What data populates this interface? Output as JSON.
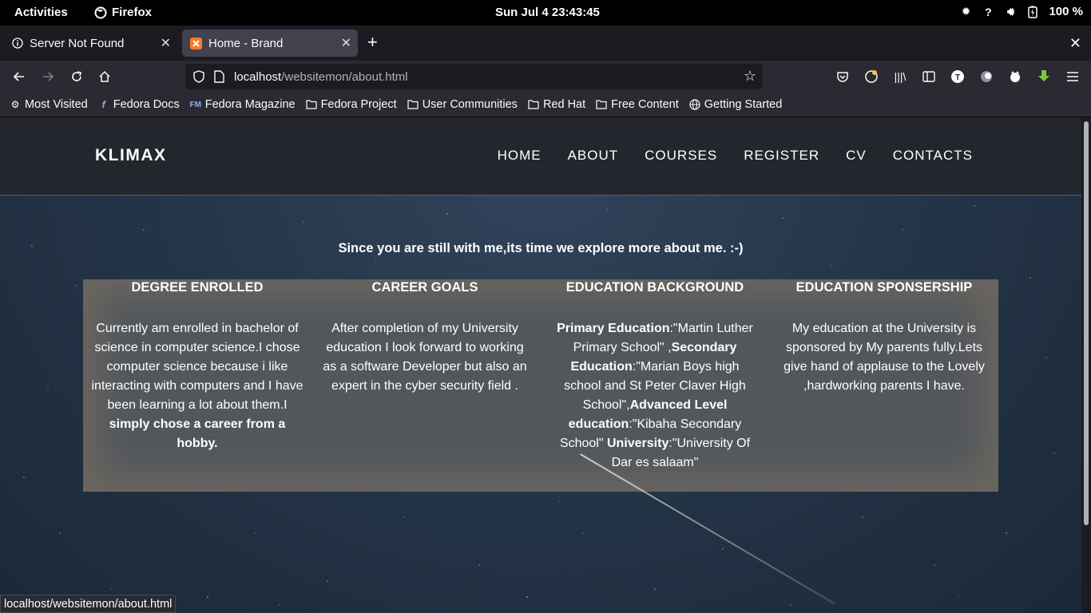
{
  "gnome": {
    "activities": "Activities",
    "app_name": "Firefox",
    "clock": "Sun Jul 4  23:43:45",
    "battery": "100 %"
  },
  "tabs": [
    {
      "title": "Server Not Found",
      "icon": "info-icon"
    },
    {
      "title": "Home - Brand",
      "icon": "xampp-icon"
    }
  ],
  "url": {
    "host": "localhost",
    "path": "/websitemon/about.html"
  },
  "bookmarks": [
    {
      "label": "Most Visited",
      "icon": "gear-icon"
    },
    {
      "label": "Fedora Docs",
      "icon": "fedora-icon"
    },
    {
      "label": "Fedora Magazine",
      "icon": "fm-icon"
    },
    {
      "label": "Fedora Project",
      "icon": "folder-icon"
    },
    {
      "label": "User Communities",
      "icon": "folder-icon"
    },
    {
      "label": "Red Hat",
      "icon": "folder-icon"
    },
    {
      "label": "Free Content",
      "icon": "folder-icon"
    },
    {
      "label": "Getting Started",
      "icon": "globe-icon"
    }
  ],
  "site": {
    "brand": "KLIMAX",
    "menu": [
      "HOME",
      "ABOUT",
      "COURSES",
      "REGISTER",
      "CV",
      "CONTACTS"
    ],
    "tagline": "Since you are still with me,its time we explore more about me.  :-)",
    "sections": {
      "degree": {
        "title": "DEGREE ENROLLED",
        "text": "Currently am enrolled in bachelor of science in computer science.I chose computer science because i like interacting with computers and I have been learning a lot about them.I ",
        "bold": "simply chose a career from a hobby."
      },
      "career": {
        "title": "CAREER GOALS",
        "text": "After completion of my University education I look  forward to working as a software Developer but also an expert in the cyber security field ."
      },
      "education": {
        "title": "EDUCATION BACKGROUND",
        "primary_label": "Primary Education",
        "primary_text": ":\"Martin Luther Primary School\" ,",
        "secondary_label": "Secondary Education",
        "secondary_text": ":\"Marian Boys high school and St Peter Claver High School\",",
        "advanced_label": "Advanced Level education",
        "advanced_text": ":\"Kibaha Secondary School\" ",
        "university_label": "University",
        "university_text": ":\"University Of Dar es salaam\""
      },
      "sponsorship": {
        "title": "EDUCATION SPONSERSHIP",
        "text": "My education at the University is sponsored by My parents fully.Lets give hand of applause to the Lovely ,hardworking parents I have."
      }
    }
  },
  "status_url": "localhost/websitemon/about.html"
}
